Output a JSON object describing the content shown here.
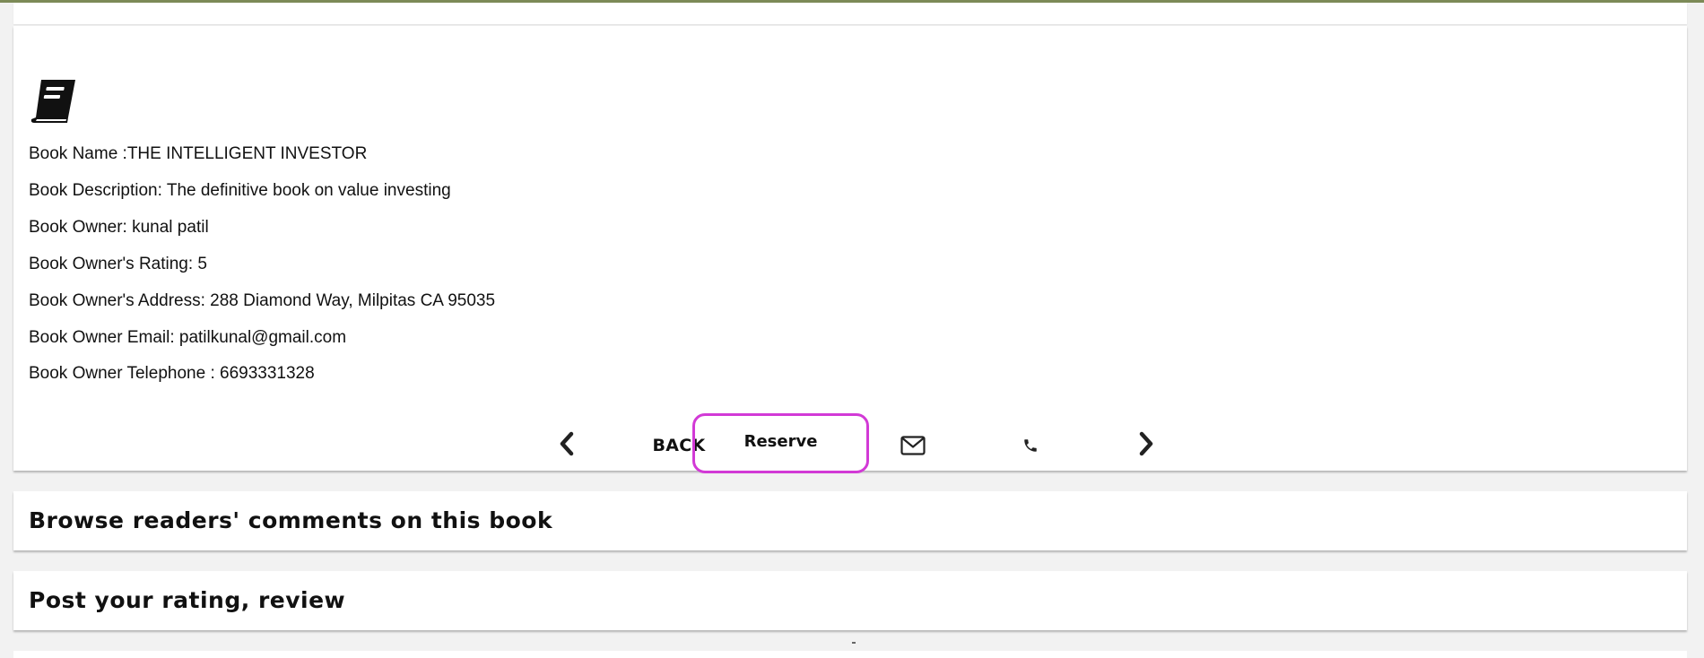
{
  "book": {
    "name_line": "Book Name :THE INTELLIGENT INVESTOR",
    "description_line": "Book Description: The definitive book on value investing",
    "owner_line": "Book Owner: kunal patil",
    "rating_line": "Book Owner's Rating: 5",
    "address_line": "Book Owner's Address: 288 Diamond Way, Milpitas CA 95035",
    "email_line": "Book Owner Email: patilkunal@gmail.com",
    "telephone_line": "Book Owner Telephone : 6693331328"
  },
  "actions": {
    "back_label": "BACK",
    "reserve_label": "Reserve"
  },
  "icons": {
    "book": "book-icon",
    "prev": "chevron-left-icon",
    "next": "chevron-right-icon",
    "email": "envelope-icon",
    "phone": "phone-icon"
  },
  "sections": {
    "comments_title": "Browse readers' comments on this book",
    "review_title": "Post your rating, review"
  },
  "colors": {
    "highlight": "#d23ad6",
    "text": "#111111"
  }
}
